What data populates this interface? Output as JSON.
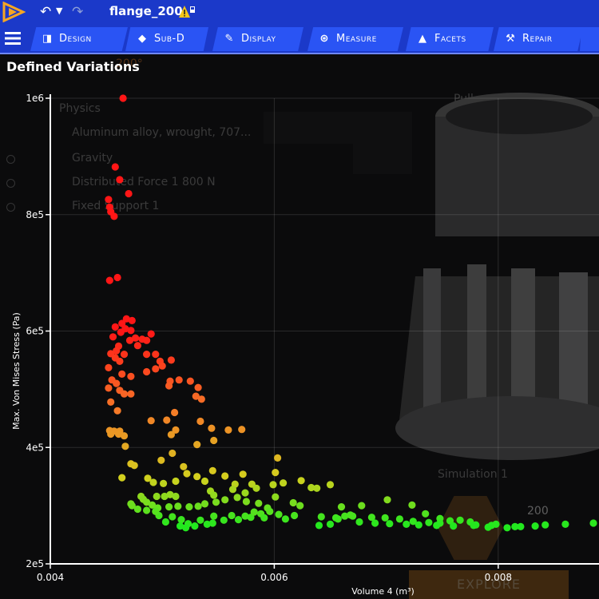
{
  "header": {
    "document_title": "flange_200"
  },
  "tabs": [
    {
      "label": "Design",
      "icon": "design-icon"
    },
    {
      "label": "Sub-D",
      "icon": "subd-icon"
    },
    {
      "label": "Display",
      "icon": "display-icon"
    },
    {
      "label": "Measure",
      "icon": "measure-icon"
    },
    {
      "label": "Facets",
      "icon": "facets-icon"
    },
    {
      "label": "Repair",
      "icon": "repair-icon"
    }
  ],
  "panel": {
    "title": "Defined Variations"
  },
  "background": {
    "angle_label": "200°",
    "tree": [
      "Physics",
      "Aluminum alloy, wrought, 707...",
      "Gravity",
      "Distributed Force 1    800 N",
      "Fixed Support 1"
    ],
    "pull_label": "Pull",
    "simulation_label": "Simulation 1",
    "hex_value": "200",
    "explore_label": "EXPLORE"
  },
  "colors": {
    "accent": "#1b39c9",
    "tab": "#2a54f4",
    "low": "#22e81e",
    "high": "#ff1616"
  },
  "chart_data": {
    "type": "scatter",
    "xlabel": "Volume 4 (m³)",
    "ylabel": "Max. Von Mises Stress (Pa)",
    "xlim": [
      0.004,
      0.0089
    ],
    "ylim": [
      200000,
      1000000
    ],
    "xticks": [
      {
        "value": 0.004,
        "label": "0.004"
      },
      {
        "value": 0.006,
        "label": "0.006"
      },
      {
        "value": 0.008,
        "label": "0.008"
      }
    ],
    "yticks": [
      {
        "value": 200000,
        "label": "2e5"
      },
      {
        "value": 400000,
        "label": "4e5"
      },
      {
        "value": 600000,
        "label": "6e5"
      },
      {
        "value": 800000,
        "label": "8e5"
      },
      {
        "value": 1000000,
        "label": "1e6"
      }
    ],
    "grid": true,
    "color_scale": "stress: green (low) to red (high)",
    "points": [
      [
        0.00465,
        1000000
      ],
      [
        0.00458,
        882000
      ],
      [
        0.00462,
        860000
      ],
      [
        0.0047,
        836000
      ],
      [
        0.00452,
        826000
      ],
      [
        0.00453,
        813000
      ],
      [
        0.00454,
        805000
      ],
      [
        0.00457,
        797000
      ],
      [
        0.00453,
        687000
      ],
      [
        0.0046,
        692000
      ],
      [
        0.00468,
        621000
      ],
      [
        0.00473,
        618000
      ],
      [
        0.00464,
        613000
      ],
      [
        0.00458,
        607000
      ],
      [
        0.00467,
        604000
      ],
      [
        0.00472,
        601000
      ],
      [
        0.00463,
        598000
      ],
      [
        0.00456,
        590000
      ],
      [
        0.00476,
        588000
      ],
      [
        0.00471,
        584000
      ],
      [
        0.00461,
        574000
      ],
      [
        0.00459,
        566000
      ],
      [
        0.00454,
        561000
      ],
      [
        0.00466,
        560000
      ],
      [
        0.00458,
        554000
      ],
      [
        0.00462,
        548000
      ],
      [
        0.00452,
        537000
      ],
      [
        0.00464,
        526000
      ],
      [
        0.00455,
        516000
      ],
      [
        0.00459,
        510000
      ],
      [
        0.00452,
        502000
      ],
      [
        0.00462,
        498000
      ],
      [
        0.00466,
        492000
      ],
      [
        0.00472,
        492000
      ],
      [
        0.00454,
        478000
      ],
      [
        0.0046,
        463000
      ],
      [
        0.00453,
        429000
      ],
      [
        0.00457,
        428000
      ],
      [
        0.00462,
        428000
      ],
      [
        0.00466,
        420000
      ],
      [
        0.00454,
        423000
      ],
      [
        0.00461,
        423000
      ],
      [
        0.0049,
        595000
      ],
      [
        0.00482,
        586000
      ],
      [
        0.00486,
        584000
      ],
      [
        0.00478,
        575000
      ],
      [
        0.00494,
        560000
      ],
      [
        0.00486,
        560000
      ],
      [
        0.00508,
        550000
      ],
      [
        0.00498,
        548000
      ],
      [
        0.005,
        540000
      ],
      [
        0.00494,
        535000
      ],
      [
        0.00486,
        530000
      ],
      [
        0.00472,
        522000
      ],
      [
        0.00507,
        514000
      ],
      [
        0.00515,
        516000
      ],
      [
        0.00525,
        514000
      ],
      [
        0.00506,
        506000
      ],
      [
        0.00532,
        503000
      ],
      [
        0.0053,
        488000
      ],
      [
        0.00535,
        483000
      ],
      [
        0.00511,
        460000
      ],
      [
        0.00467,
        402000
      ],
      [
        0.00472,
        372000
      ],
      [
        0.00464,
        348000
      ],
      [
        0.0049,
        446000
      ],
      [
        0.00504,
        447000
      ],
      [
        0.00534,
        445000
      ],
      [
        0.00512,
        430000
      ],
      [
        0.00508,
        422000
      ],
      [
        0.00544,
        433000
      ],
      [
        0.00559,
        430000
      ],
      [
        0.00571,
        431000
      ],
      [
        0.00546,
        412000
      ],
      [
        0.00531,
        405000
      ],
      [
        0.00509,
        390000
      ],
      [
        0.00475,
        369000
      ],
      [
        0.00487,
        347000
      ],
      [
        0.00499,
        378000
      ],
      [
        0.00519,
        367000
      ],
      [
        0.00522,
        355000
      ],
      [
        0.00531,
        350000
      ],
      [
        0.00492,
        340000
      ],
      [
        0.00501,
        338000
      ],
      [
        0.00512,
        342000
      ],
      [
        0.00538,
        342000
      ],
      [
        0.00556,
        351000
      ],
      [
        0.00572,
        354000
      ],
      [
        0.00545,
        360000
      ],
      [
        0.00565,
        337000
      ],
      [
        0.0058,
        337000
      ],
      [
        0.00563,
        328000
      ],
      [
        0.00574,
        322000
      ],
      [
        0.00584,
        330000
      ],
      [
        0.00543,
        325000
      ],
      [
        0.00507,
        319000
      ],
      [
        0.00512,
        316000
      ],
      [
        0.00502,
        316000
      ],
      [
        0.00495,
        316000
      ],
      [
        0.00481,
        316000
      ],
      [
        0.00483,
        311000
      ],
      [
        0.00486,
        306000
      ],
      [
        0.00472,
        303000
      ],
      [
        0.00473,
        300000
      ],
      [
        0.00491,
        301000
      ],
      [
        0.00478,
        294000
      ],
      [
        0.00486,
        292000
      ],
      [
        0.00496,
        296000
      ],
      [
        0.00506,
        298000
      ],
      [
        0.00514,
        299000
      ],
      [
        0.00524,
        298000
      ],
      [
        0.00532,
        299000
      ],
      [
        0.00538,
        303000
      ],
      [
        0.00548,
        306000
      ],
      [
        0.00556,
        310000
      ],
      [
        0.00546,
        318000
      ],
      [
        0.00567,
        314000
      ],
      [
        0.00575,
        307000
      ],
      [
        0.00586,
        304000
      ],
      [
        0.00594,
        296000
      ],
      [
        0.00596,
        290000
      ],
      [
        0.00588,
        286000
      ],
      [
        0.00579,
        280000
      ],
      [
        0.00568,
        276000
      ],
      [
        0.00555,
        275000
      ],
      [
        0.00545,
        270000
      ],
      [
        0.0054,
        268000
      ],
      [
        0.00529,
        265000
      ],
      [
        0.00523,
        269000
      ],
      [
        0.00517,
        276000
      ],
      [
        0.00509,
        281000
      ],
      [
        0.00497,
        283000
      ],
      [
        0.00494,
        290000
      ],
      [
        0.00503,
        272000
      ],
      [
        0.00516,
        265000
      ],
      [
        0.00521,
        262000
      ],
      [
        0.00534,
        275000
      ],
      [
        0.00546,
        282000
      ],
      [
        0.00562,
        283000
      ],
      [
        0.00574,
        282000
      ],
      [
        0.00582,
        289000
      ],
      [
        0.00591,
        279000
      ],
      [
        0.00604,
        285000
      ],
      [
        0.0061,
        277000
      ],
      [
        0.00623,
        300000
      ],
      [
        0.00617,
        305000
      ],
      [
        0.00601,
        315000
      ],
      [
        0.00599,
        336000
      ],
      [
        0.00601,
        357000
      ],
      [
        0.00603,
        382000
      ],
      [
        0.00608,
        339000
      ],
      [
        0.00624,
        343000
      ],
      [
        0.00633,
        331000
      ],
      [
        0.00638,
        330000
      ],
      [
        0.0065,
        336000
      ],
      [
        0.0066,
        298000
      ],
      [
        0.00678,
        300000
      ],
      [
        0.00701,
        310000
      ],
      [
        0.00723,
        301000
      ],
      [
        0.00735,
        286000
      ],
      [
        0.00748,
        278000
      ],
      [
        0.00766,
        275000
      ],
      [
        0.0078,
        267000
      ],
      [
        0.00794,
        266000
      ],
      [
        0.00808,
        262000
      ],
      [
        0.0082,
        264000
      ],
      [
        0.00833,
        265000
      ],
      [
        0.00842,
        267000
      ],
      [
        0.0086,
        268000
      ],
      [
        0.00885,
        270000
      ],
      [
        0.00618,
        283000
      ],
      [
        0.00642,
        281000
      ],
      [
        0.00655,
        279000
      ],
      [
        0.00663,
        282000
      ],
      [
        0.0067,
        282000
      ],
      [
        0.00687,
        280000
      ],
      [
        0.00699,
        279000
      ],
      [
        0.00712,
        277000
      ],
      [
        0.00724,
        273000
      ],
      [
        0.00738,
        271000
      ],
      [
        0.00748,
        270000
      ],
      [
        0.00757,
        274000
      ],
      [
        0.00775,
        272000
      ],
      [
        0.00798,
        268000
      ],
      [
        0.00815,
        264000
      ],
      [
        0.0064,
        266000
      ],
      [
        0.0065,
        268000
      ],
      [
        0.00657,
        277000
      ],
      [
        0.00668,
        284000
      ],
      [
        0.00676,
        272000
      ],
      [
        0.0069,
        270000
      ],
      [
        0.00703,
        269000
      ],
      [
        0.00718,
        268000
      ],
      [
        0.00729,
        267000
      ],
      [
        0.00745,
        266000
      ],
      [
        0.0076,
        265000
      ],
      [
        0.00778,
        266000
      ],
      [
        0.00791,
        263000
      ]
    ]
  }
}
